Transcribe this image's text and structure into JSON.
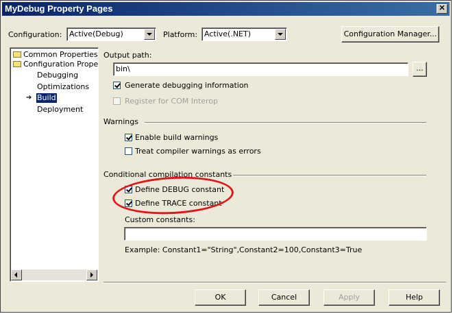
{
  "window": {
    "title": "MyDebug Property Pages"
  },
  "config_bar": {
    "configuration_label": "Configuration:",
    "configuration_value": "Active(Debug)",
    "platform_label": "Platform:",
    "platform_value": "Active(.NET)",
    "config_manager_label": "Configuration Manager..."
  },
  "tree": {
    "items": [
      {
        "label": "Common Properties"
      },
      {
        "label": "Configuration Propertie"
      },
      {
        "label": "Debugging"
      },
      {
        "label": "Optimizations"
      },
      {
        "label": "Build"
      },
      {
        "label": "Deployment"
      }
    ]
  },
  "build": {
    "output_path_label": "Output path:",
    "output_path_value": "bin\\",
    "browse_label": "...",
    "generate_debug_info": "Generate debugging information",
    "register_com": "Register for COM Interop",
    "warnings_header": "Warnings",
    "enable_build_warnings": "Enable build warnings",
    "treat_warnings_as_errors": "Treat compiler warnings as errors",
    "conditional_header": "Conditional compilation constants",
    "define_debug": "Define DEBUG constant",
    "define_trace": "Define TRACE constant",
    "custom_constants_label": "Custom constants:",
    "custom_constants_value": "",
    "example_text": "Example: Constant1=\"String\",Constant2=100,Constant3=True"
  },
  "footer": {
    "ok_label": "OK",
    "cancel_label": "Cancel",
    "apply_label": "Apply",
    "help_label": "Help"
  },
  "colors": {
    "titlebar": "#0a246a",
    "dialog_bg": "#ece9d8",
    "annotation_oval": "#e0161b",
    "tree_selection": "#0a246a"
  }
}
